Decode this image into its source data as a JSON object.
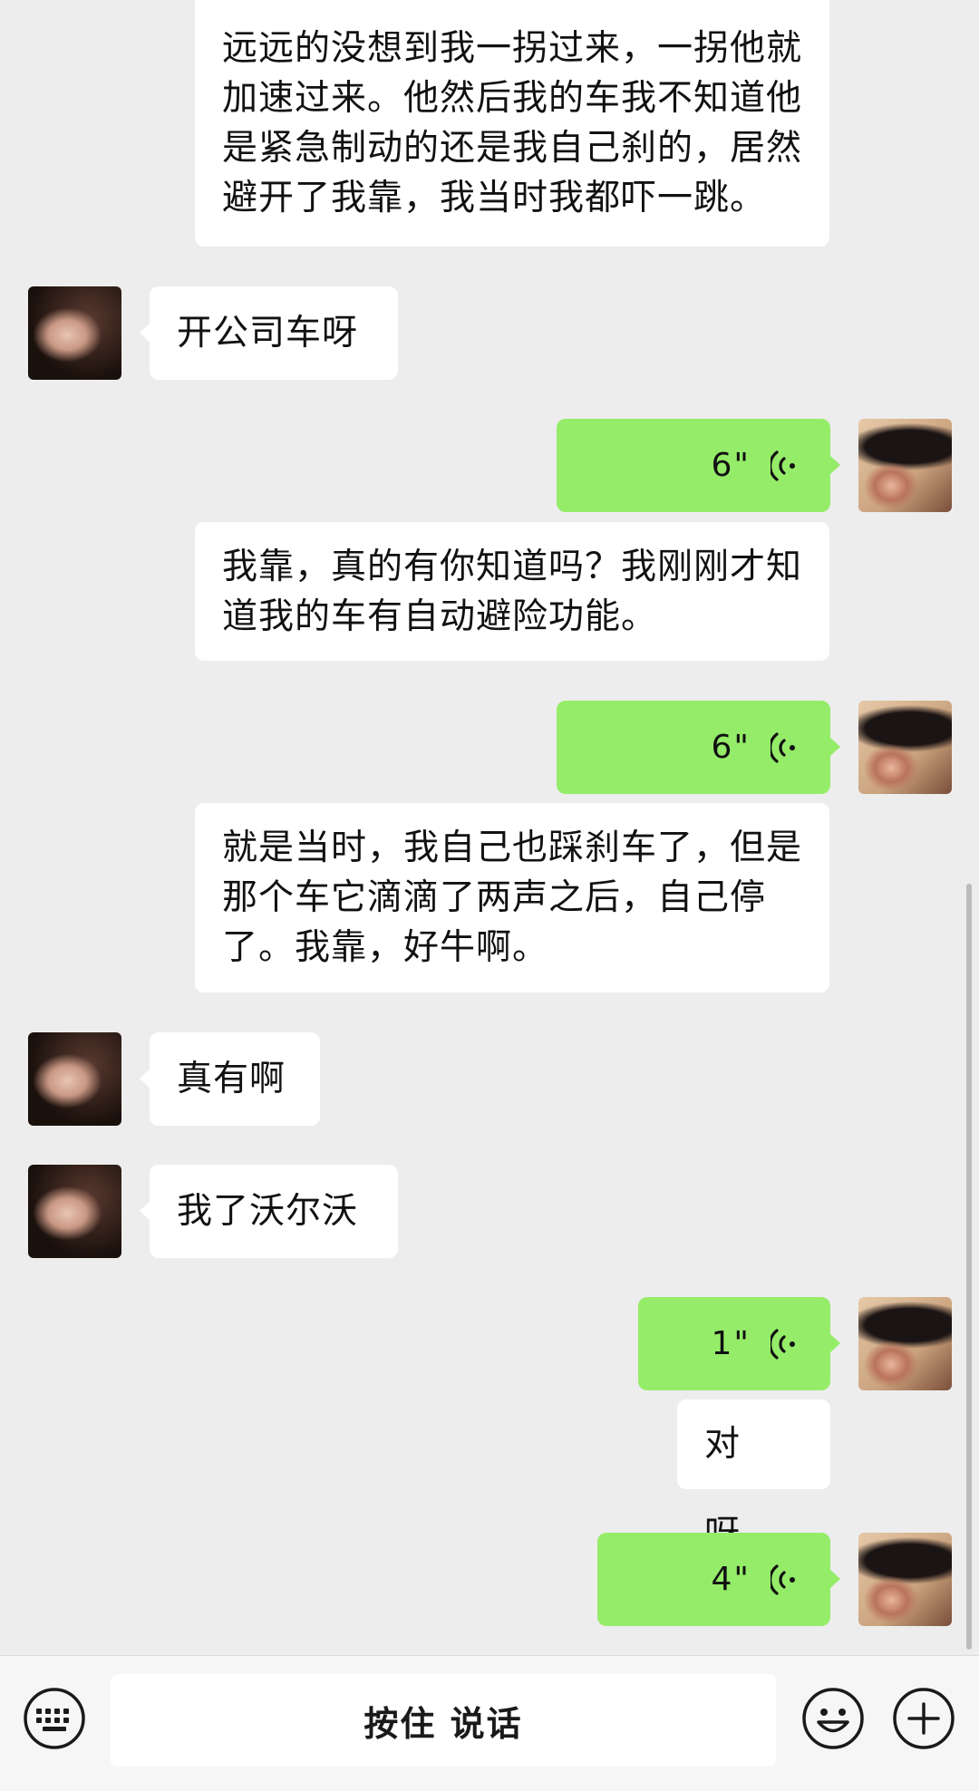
{
  "messages": {
    "m1": "远远的没想到我一拐过来，一拐他就加速过来。他然后我的车我不知道他是紧急制动的还是我自己刹的，居然避开了我靠，我当时我都吓一跳。",
    "m2": "开公司车呀",
    "m3_voice": "6\"",
    "m4": "我靠，真的有你知道吗？我刚刚才知道我的车有自动避险功能。",
    "m5_voice": "6\"",
    "m6": "就是当时，我自己也踩刹车了，但是那个车它滴滴了两声之后，自己停了。我靠，好牛啊。",
    "m7": "真有啊",
    "m8": "我了沃尔沃",
    "m9_voice": "1\"",
    "m10": "对呀。",
    "m11_voice": "4\""
  },
  "toolbar": {
    "hold_to_talk": "按住 说话",
    "icons": [
      "keyboard-icon",
      "emoji-icon",
      "plus-icon"
    ]
  },
  "colors": {
    "background": "#ededed",
    "sent_bubble": "#95ec69",
    "received_bubble": "#ffffff"
  }
}
